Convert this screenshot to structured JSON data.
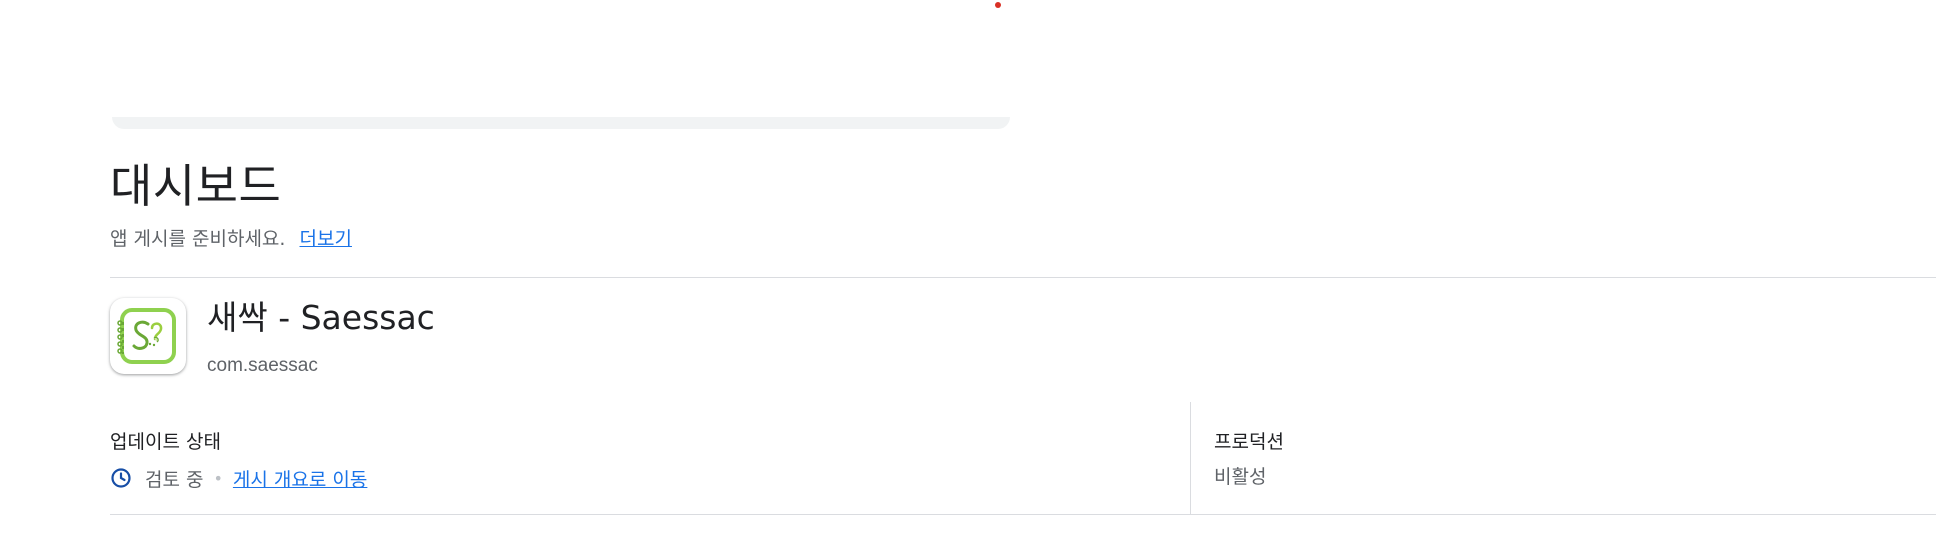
{
  "header": {
    "title": "대시보드",
    "subtitle": "앱 게시를 준비하세요.",
    "learn_more_link": "더보기"
  },
  "app": {
    "icon": "saessac-app-icon",
    "name": "새싹 - Saessac",
    "package": "com.saessac"
  },
  "update_status": {
    "label": "업데이트 상태",
    "icon": "clock-icon",
    "status": "검토 중",
    "separator": "•",
    "link": "게시 개요로 이동"
  },
  "production": {
    "label": "프로덕션",
    "value": "비활성"
  },
  "colors": {
    "link": "#1a73e8",
    "text_primary": "#202124",
    "text_secondary": "#5f6368",
    "divider": "#dadce0",
    "icon_green": "#7cc242",
    "clock_blue": "#174ea6"
  }
}
